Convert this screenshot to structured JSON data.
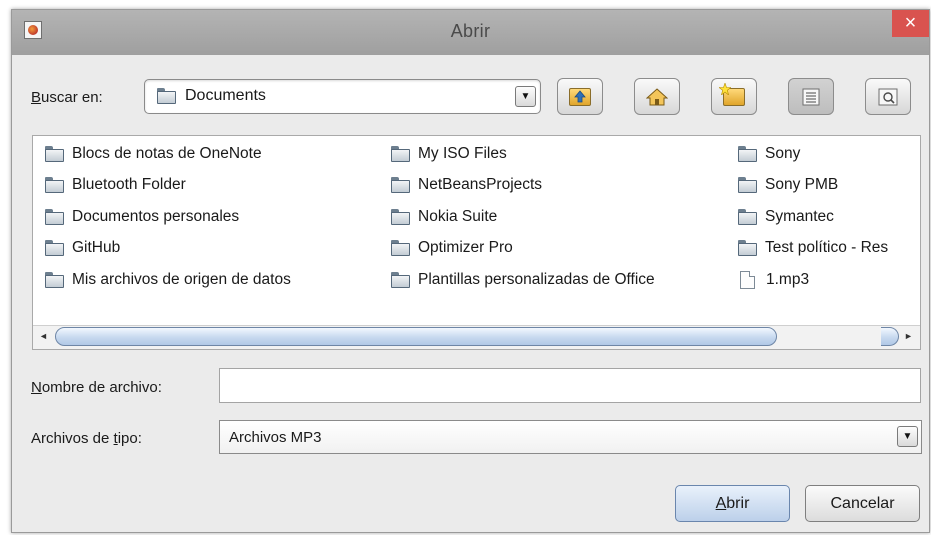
{
  "window": {
    "title": "Abrir",
    "close_label": "×"
  },
  "look_in": {
    "label_mnemonic": "B",
    "label_rest": "uscar en:",
    "value": "Documents"
  },
  "toolbar": {
    "buttons": [
      {
        "name": "up-one-level",
        "icon": "folder-up-icon"
      },
      {
        "name": "home",
        "icon": "home-icon"
      },
      {
        "name": "new-folder",
        "icon": "new-folder-icon"
      },
      {
        "name": "list-view",
        "icon": "list-view-icon",
        "pressed": true
      },
      {
        "name": "details-view",
        "icon": "details-view-icon"
      }
    ]
  },
  "files": {
    "columns": [
      [
        "Blocs de notas de OneNote",
        "Bluetooth Folder",
        "Documentos personales",
        "GitHub",
        "Mis archivos de origen de datos"
      ],
      [
        "My ISO Files",
        "NetBeansProjects",
        "Nokia Suite",
        "Optimizer Pro",
        "Plantillas personalizadas de Office"
      ],
      [
        "Sony",
        "Sony PMB",
        "Symantec",
        "Test político - Res",
        "1.mp3"
      ]
    ]
  },
  "filename": {
    "label_mnemonic": "N",
    "label_rest": "ombre de archivo:",
    "value": ""
  },
  "filetype": {
    "label_pre": "Archivos de ",
    "label_mnemonic": "t",
    "label_rest": "ipo:",
    "value": "Archivos MP3"
  },
  "actions": {
    "open_mnemonic": "A",
    "open_rest": "brir",
    "cancel": "Cancelar"
  },
  "colors": {
    "titlebar": "#a8a8a8",
    "close": "#d9534f",
    "scroll_thumb": "#c7d9ef",
    "dialog_bg": "#ebebeb"
  }
}
